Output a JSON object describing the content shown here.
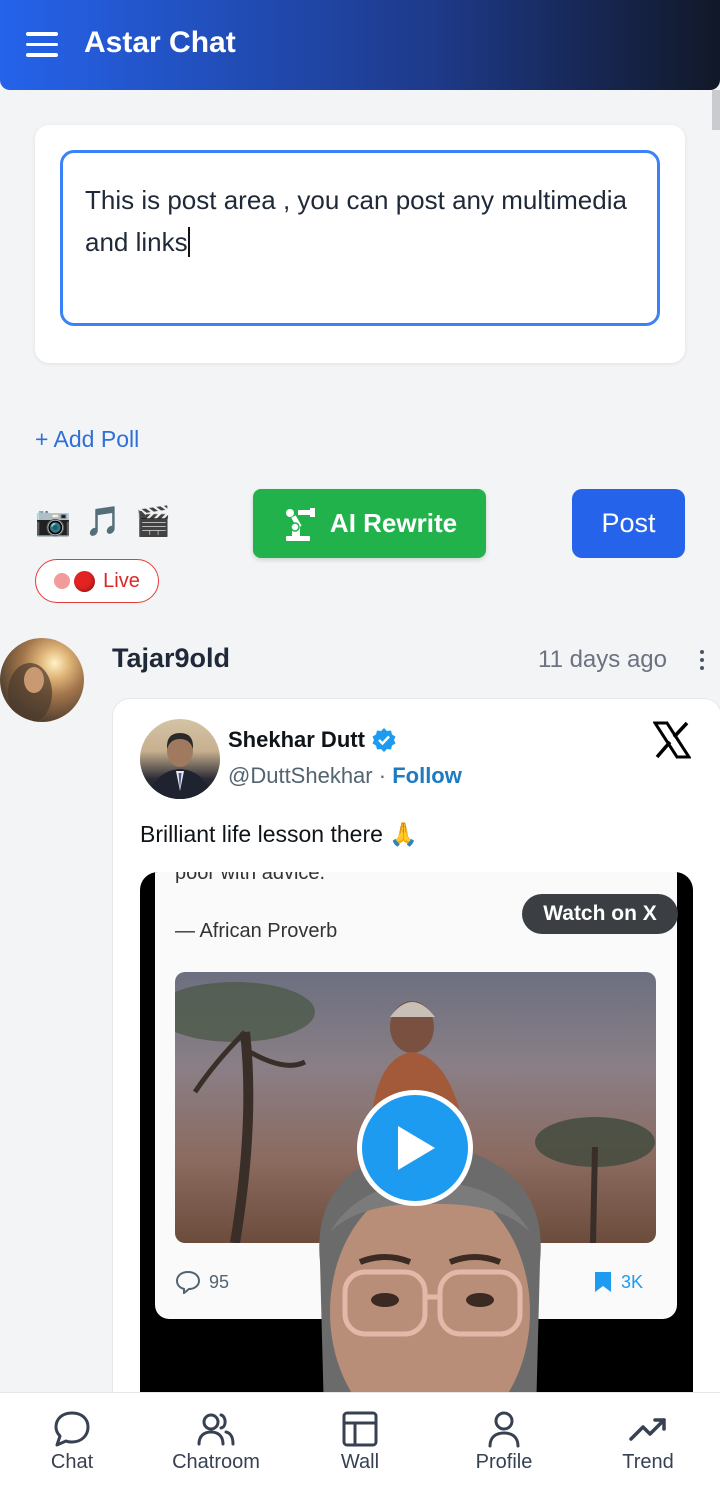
{
  "header": {
    "title": "Astar Chat",
    "menu_icon": "hamburger-menu-icon"
  },
  "composer": {
    "text": "This is post area , you can post any multimedia and links",
    "add_poll_label": "+ Add Poll",
    "media_icons": [
      "camera-icon",
      "music-icon",
      "clapper-icon"
    ],
    "ai_rewrite_label": "AI Rewrite",
    "post_label": "Post",
    "live_label": "Live"
  },
  "feed_post": {
    "username": "Tajar9old",
    "time": "11 days ago",
    "embed": {
      "author_name": "Shekhar Dutt",
      "author_handle": "@DuttShekhar",
      "separator": "·",
      "follow_label": "Follow",
      "text": "Brilliant life lesson there 🙏",
      "quote_partial": "poor with advice.",
      "quote_attribution": "— African Proverb",
      "watch_label": "Watch on X",
      "comments": "95",
      "bookmarks": "3K"
    }
  },
  "nav": [
    {
      "label": "Chat",
      "icon": "chat-bubble-icon"
    },
    {
      "label": "Chatroom",
      "icon": "users-icon"
    },
    {
      "label": "Wall",
      "icon": "wall-layout-icon"
    },
    {
      "label": "Profile",
      "icon": "profile-icon"
    },
    {
      "label": "Trend",
      "icon": "trend-icon"
    }
  ],
  "colors": {
    "primary": "#2563eb",
    "ai_green": "#22b24c",
    "live_red": "#dc2626",
    "x_blue": "#1d9bf0"
  }
}
